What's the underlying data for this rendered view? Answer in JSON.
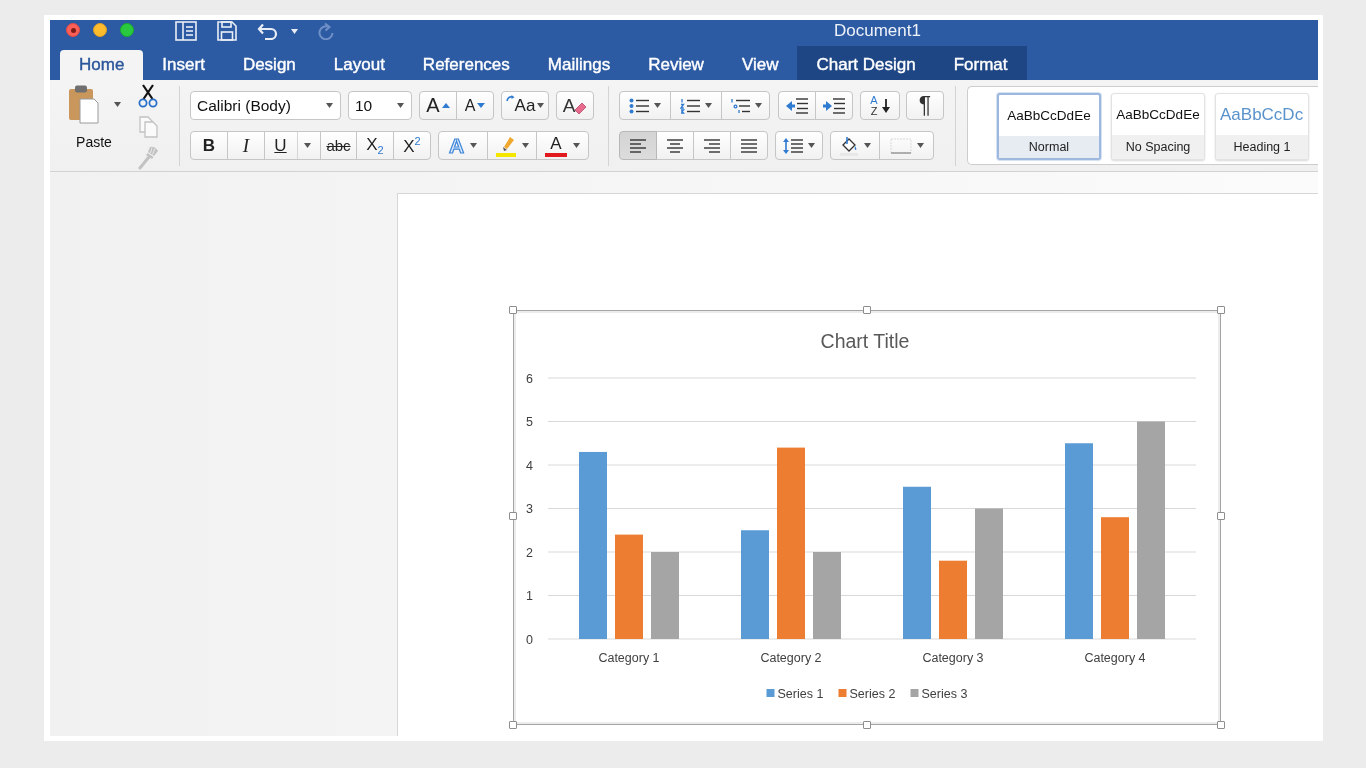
{
  "window": {
    "title": "Document1"
  },
  "quick_access": [
    {
      "kind": "sidebar",
      "disabled": false
    },
    {
      "kind": "save",
      "disabled": false
    },
    {
      "kind": "undo",
      "disabled": false
    },
    {
      "kind": "redo",
      "disabled": true
    }
  ],
  "tabs": [
    {
      "label": "Home",
      "selected": true,
      "contextual": false
    },
    {
      "label": "Insert",
      "selected": false,
      "contextual": false
    },
    {
      "label": "Design",
      "selected": false,
      "contextual": false
    },
    {
      "label": "Layout",
      "selected": false,
      "contextual": false
    },
    {
      "label": "References",
      "selected": false,
      "contextual": false
    },
    {
      "label": "Mailings",
      "selected": false,
      "contextual": false
    },
    {
      "label": "Review",
      "selected": false,
      "contextual": false
    },
    {
      "label": "View",
      "selected": false,
      "contextual": false
    },
    {
      "label": "Chart Design",
      "selected": false,
      "contextual": true
    },
    {
      "label": "Format",
      "selected": false,
      "contextual": true
    }
  ],
  "clipboard": {
    "paste_label": "Paste",
    "tools": [
      {
        "kind": "cut",
        "disabled": false
      },
      {
        "kind": "copy",
        "disabled": true
      },
      {
        "kind": "format_painter",
        "disabled": true
      }
    ]
  },
  "font": {
    "font_name": "Calibri (Body)",
    "font_size": "10",
    "size_buttons": [
      {
        "kind": "grow",
        "label": "A"
      },
      {
        "kind": "shrink",
        "label": "A"
      }
    ],
    "change_case_label": "Aa",
    "clear_formatting_label": "A",
    "format_buttons": [
      {
        "kind": "bold",
        "label": "B"
      },
      {
        "kind": "italic",
        "label": "I"
      },
      {
        "kind": "underline",
        "label": "U"
      },
      {
        "kind": "strikethrough",
        "label": "abc"
      },
      {
        "kind": "subscript",
        "label": "X$_{2}$"
      },
      {
        "kind": "superscript",
        "label": "X$^{2}$"
      }
    ],
    "text_effects_label": "A",
    "font_color_label": "A"
  },
  "paragraph": {
    "sort_letters": [
      "A",
      "Z"
    ],
    "show_marks": "¶",
    "alignment": [
      {
        "kind": "left",
        "selected": true
      },
      {
        "kind": "center",
        "selected": false
      },
      {
        "kind": "right",
        "selected": false
      },
      {
        "kind": "justify",
        "selected": false
      }
    ]
  },
  "styles": [
    {
      "kind": "normal",
      "preview": "AaBbCcDdEe",
      "name": "Normal",
      "selected": true
    },
    {
      "kind": "normal",
      "preview": "AaBbCcDdEe",
      "name": "No Spacing",
      "selected": false
    },
    {
      "kind": "heading",
      "preview": "AaBbCcDc",
      "name": "Heading 1",
      "selected": false
    }
  ],
  "document": {
    "chart_data": {
      "type": "bar",
      "title": "Chart Title",
      "categories": [
        "Category 1",
        "Category 2",
        "Category 3",
        "Category 4"
      ],
      "series": [
        {
          "name": "Series 1",
          "color": "#5b9bd5",
          "values": [
            4.3,
            2.5,
            3.5,
            4.5
          ]
        },
        {
          "name": "Series 2",
          "color": "#ed7d31",
          "values": [
            2.4,
            4.4,
            1.8,
            2.8
          ]
        },
        {
          "name": "Series 3",
          "color": "#a5a5a5",
          "values": [
            2,
            2,
            3,
            5
          ]
        }
      ],
      "ylim": [
        0,
        6
      ],
      "yticks": [
        0,
        1,
        2,
        3,
        4,
        5,
        6
      ],
      "grid": true,
      "legend": true
    }
  }
}
